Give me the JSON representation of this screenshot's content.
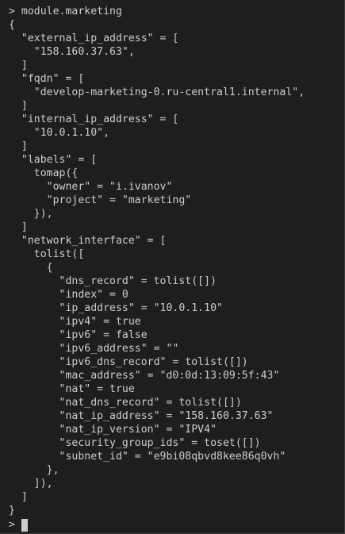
{
  "terminal": {
    "lines": [
      "> module.marketing",
      "{",
      "  \"external_ip_address\" = [",
      "    \"158.160.37.63\",",
      "  ]",
      "  \"fqdn\" = [",
      "    \"develop-marketing-0.ru-central1.internal\",",
      "  ]",
      "  \"internal_ip_address\" = [",
      "    \"10.0.1.10\",",
      "  ]",
      "  \"labels\" = [",
      "    tomap({",
      "      \"owner\" = \"i.ivanov\"",
      "      \"project\" = \"marketing\"",
      "    }),",
      "  ]",
      "  \"network_interface\" = [",
      "    tolist([",
      "      {",
      "        \"dns_record\" = tolist([])",
      "        \"index\" = 0",
      "        \"ip_address\" = \"10.0.1.10\"",
      "        \"ipv4\" = true",
      "        \"ipv6\" = false",
      "        \"ipv6_address\" = \"\"",
      "        \"ipv6_dns_record\" = tolist([])",
      "        \"mac_address\" = \"d0:0d:13:09:5f:43\"",
      "        \"nat\" = true",
      "        \"nat_dns_record\" = tolist([])",
      "        \"nat_ip_address\" = \"158.160.37.63\"",
      "        \"nat_ip_version\" = \"IPV4\"",
      "        \"security_group_ids\" = toset([])",
      "        \"subnet_id\" = \"e9bi08qbvd8kee86q0vh\"",
      "      },",
      "    ]),",
      "  ]",
      "}"
    ],
    "prompt": "> ",
    "colors": {
      "background": "#1e1e1e",
      "text": "#cccccc",
      "cursor": "#cccccc"
    }
  }
}
